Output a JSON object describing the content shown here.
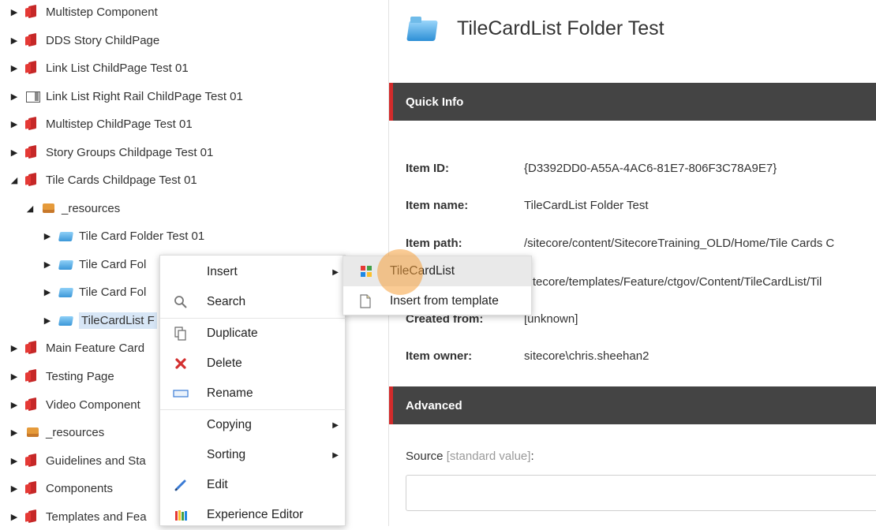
{
  "tree": {
    "items": [
      {
        "label": "Multistep Component",
        "icon": "page-icon",
        "expanded": false
      },
      {
        "label": "DDS Story ChildPage",
        "icon": "page-icon",
        "expanded": false
      },
      {
        "label": "Link List ChildPage Test 01",
        "icon": "page-icon",
        "expanded": false
      },
      {
        "label": "Link List Right Rail ChildPage Test 01",
        "icon": "right-rail-icon",
        "expanded": false
      },
      {
        "label": "Multistep ChildPage Test 01",
        "icon": "page-icon",
        "expanded": false
      },
      {
        "label": "Story Groups Childpage Test 01",
        "icon": "page-icon",
        "expanded": false
      },
      {
        "label": "Tile Cards Childpage Test 01",
        "icon": "page-icon",
        "expanded": true
      },
      {
        "label": "_resources",
        "icon": "box-icon",
        "expanded": true
      },
      {
        "label": "Tile Card Folder Test 01",
        "icon": "folder-icon",
        "expanded": false
      },
      {
        "label": "Tile Card Fol",
        "icon": "folder-icon",
        "expanded": false
      },
      {
        "label": "Tile Card Fol",
        "icon": "folder-icon",
        "expanded": false
      },
      {
        "label": "TileCardList F",
        "icon": "folder-icon",
        "expanded": false,
        "selected": true
      },
      {
        "label": "Main Feature Card",
        "icon": "page-icon",
        "expanded": false
      },
      {
        "label": "Testing Page",
        "icon": "page-icon",
        "expanded": false
      },
      {
        "label": "Video Component",
        "icon": "page-icon",
        "expanded": false
      },
      {
        "label": "_resources",
        "icon": "box-icon",
        "expanded": false
      },
      {
        "label": "Guidelines and Sta",
        "icon": "page-icon",
        "expanded": false
      },
      {
        "label": "Components",
        "icon": "page-icon",
        "expanded": false
      },
      {
        "label": "Templates and Fea",
        "icon": "page-icon",
        "expanded": false
      }
    ]
  },
  "content": {
    "title": "TileCardList Folder Test",
    "quick_info": {
      "header": "Quick Info",
      "fields": [
        {
          "label": "Item ID:",
          "value": "{D3392DD0-A55A-4AC6-81E7-806F3C78A9E7}"
        },
        {
          "label": "Item name:",
          "value": "TileCardList Folder Test"
        },
        {
          "label": "Item path:",
          "value": "/sitecore/content/SitecoreTraining_OLD/Home/Tile Cards C"
        },
        {
          "label": "",
          "value": "sitecore/templates/Feature/ctgov/Content/TileCardList/Til"
        },
        {
          "label": "Created from:",
          "value": "[unknown]"
        },
        {
          "label": "Item owner:",
          "value": "sitecore\\chris.sheehan2"
        }
      ]
    },
    "advanced": {
      "header": "Advanced",
      "source_label": "Source",
      "source_hint": "[standard value]",
      "source_colon": ":"
    }
  },
  "context_menu": {
    "items": [
      {
        "label": "Insert",
        "icon": "",
        "submenu": true
      },
      {
        "label": "Search",
        "icon": "search-icon",
        "submenu": false
      },
      {
        "label": "Duplicate",
        "icon": "duplicate-icon",
        "submenu": false
      },
      {
        "label": "Delete",
        "icon": "delete-icon",
        "submenu": false
      },
      {
        "label": "Rename",
        "icon": "rename-icon",
        "submenu": false
      },
      {
        "label": "Copying",
        "icon": "",
        "submenu": true
      },
      {
        "label": "Sorting",
        "icon": "",
        "submenu": true
      },
      {
        "label": "Edit",
        "icon": "pencil-icon",
        "submenu": false
      },
      {
        "label": "Experience Editor",
        "icon": "experience-editor-icon",
        "submenu": false
      }
    ]
  },
  "submenu": {
    "items": [
      {
        "label": "TileCardList",
        "icon": "template-cube-icon",
        "hover": true
      },
      {
        "label": "Insert from template",
        "icon": "document-icon",
        "hover": false
      }
    ]
  },
  "colors": {
    "accent": "#d22b2b",
    "section_bar": "#444444",
    "selection": "#d7e6f6",
    "cursor": "#f5a03c"
  }
}
